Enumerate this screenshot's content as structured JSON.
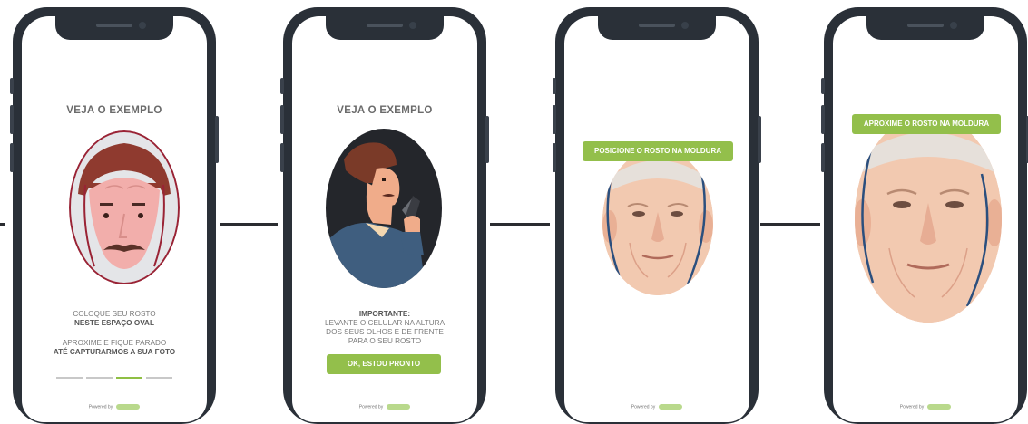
{
  "screens": [
    {
      "title": "VEJA O EXEMPLO",
      "caption_line1": "COLOQUE SEU ROSTO",
      "caption_line2": "NESTE ESPAÇO OVAL",
      "caption_line3": "APROXIME E FIQUE PARADO",
      "caption_line4": "ATÉ CAPTURARMOS A SUA FOTO",
      "powered_by": "Powered by",
      "progress_steps": 4,
      "progress_active_step": 3
    },
    {
      "title": "VEJA O EXEMPLO",
      "important_label": "IMPORTANTE:",
      "instruction_line1": "LEVANTE O CELULAR NA ALTURA",
      "instruction_line2": "DOS SEUS OLHOS E DE FRENTE",
      "instruction_line3": "PARA O SEU ROSTO",
      "button_label": "OK, ESTOU PRONTO",
      "powered_by": "Powered by"
    },
    {
      "banner": "POSICIONE O ROSTO NA MOLDURA",
      "powered_by": "Powered by"
    },
    {
      "banner": "APROXIME O ROSTO NA MOLDURA",
      "powered_by": "Powered by"
    }
  ],
  "colors": {
    "accent_green": "#93bf4b",
    "phone_frame": "#2a3038",
    "text_gray": "#6b6b6b",
    "frame_line": "#2b4f7e",
    "oval_border_red": "#a31f34"
  },
  "icons": [
    "illustrated-face",
    "man-with-phone-illustration",
    "elderly-face-photo",
    "brand-logo"
  ]
}
